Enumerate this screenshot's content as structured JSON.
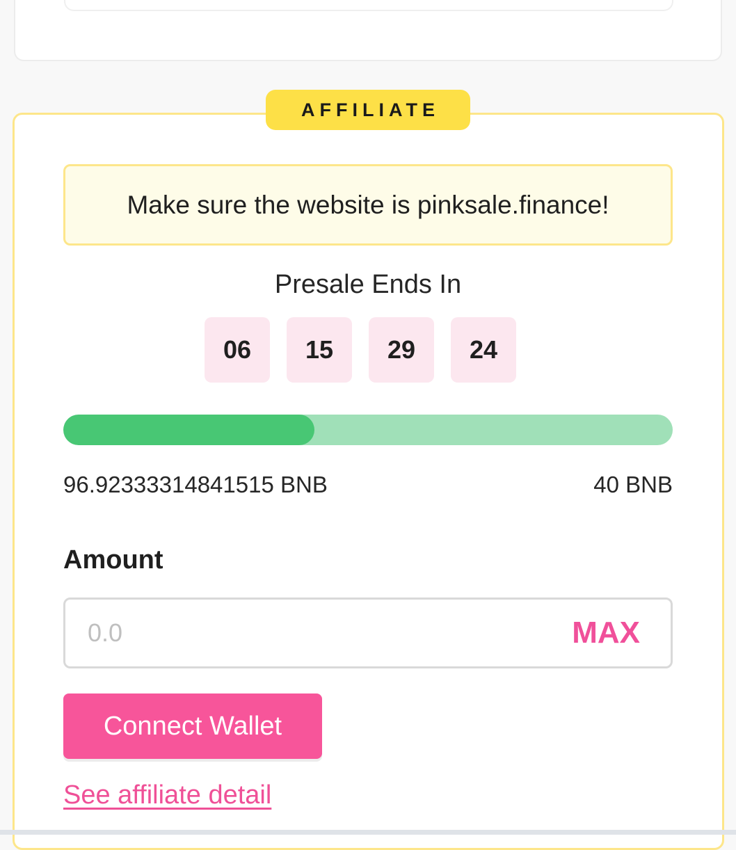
{
  "affiliate_section": {
    "badge": "AFFILIATE",
    "notice": "Make sure the website is pinksale.finance!",
    "timer_label": "Presale Ends In",
    "countdown": [
      "06",
      "15",
      "29",
      "24"
    ],
    "progress_fraction": 0.412,
    "raised": "96.92333314841515 BNB",
    "cap": "40 BNB",
    "amount_label": "Amount",
    "amount_placeholder": "0.0",
    "amount_value": "",
    "max_label": "MAX",
    "connect_label": "Connect Wallet",
    "detail_link": "See affiliate detail"
  },
  "colors": {
    "accent_pink": "#f7559a",
    "badge_yellow": "#fde047",
    "progress_fill": "#48c774",
    "progress_track": "#a0e0b8",
    "notice_bg": "#fefce8",
    "timer_box_bg": "#fce7ef"
  }
}
